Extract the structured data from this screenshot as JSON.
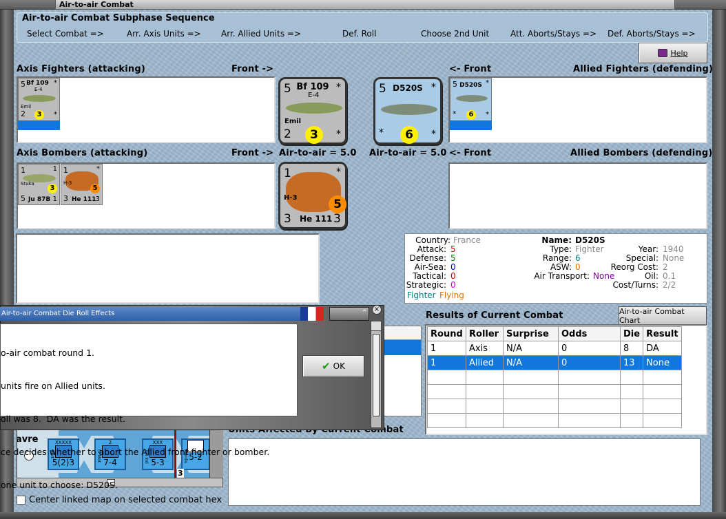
{
  "window": {
    "title": "Air-to-air Combat"
  },
  "sequence": {
    "title": "Air-to-air Combat Subphase Sequence",
    "steps": [
      "Select Combat =>",
      "Arr. Axis Units =>",
      "Arr. Allied Units =>",
      "Def. Roll",
      "Choose 2nd Unit",
      "Att. Aborts/Stays =>",
      "Def. Aborts/Stays =>"
    ]
  },
  "help_label": "Help",
  "sections": {
    "axis_fighters": "Axis Fighters (attacking)",
    "allied_fighters": "Allied Fighters (defending)",
    "axis_bombers": "Axis Bombers (attacking)",
    "allied_bombers": "Allied Bombers (defending)",
    "front_right": "Front ->",
    "front_left": "<- Front",
    "axis_air_to_air": "Air-to-air = 5.0",
    "allied_air_to_air": "Air-to-air = 5.0"
  },
  "units": {
    "bf109": {
      "name": "Bf 109",
      "variant": "E-4",
      "pilot": "Emil",
      "attack": "5",
      "defense": "2",
      "range": "3",
      "star": "*"
    },
    "d520": {
      "name": "D520S",
      "attack": "5",
      "range": "6",
      "star": "*"
    },
    "ju87": {
      "name": "Ju 87B",
      "type_label": "Stuka",
      "tl": "1",
      "tr": "1",
      "bl": "5",
      "br": "1",
      "range": "3"
    },
    "he111": {
      "name": "He 111",
      "variant": "H-3",
      "tl": "1",
      "bl": "3",
      "br": "3",
      "range": "5",
      "star": "*"
    }
  },
  "info": {
    "country_label": "Country:",
    "country": "France",
    "attack_label": "Attack:",
    "attack": "5",
    "defense_label": "Defense:",
    "defense": "5",
    "airsea_label": "Air-Sea:",
    "airsea": "0",
    "tactical_label": "Tactical:",
    "tactical": "0",
    "strategic_label": "Strategic:",
    "strategic": "0",
    "name_label": "Name:",
    "name": "D520S",
    "type_label": "Type:",
    "type": "Fighter",
    "range_label": "Range:",
    "range": "6",
    "asw_label": "ASW:",
    "asw": "0",
    "air_transport_label": "Air Transport:",
    "air_transport": "None",
    "year_label": "Year:",
    "year": "1940",
    "special_label": "Special:",
    "special": "None",
    "reorg_label": "Reorg Cost:",
    "reorg": "2",
    "oil_label": "Oil:",
    "oil": "0.1",
    "cost_label": "Cost/Turns:",
    "cost": "2/2",
    "tag1": "Fighter",
    "tag2": "Flying"
  },
  "results": {
    "title": "Results of Current Combat",
    "chart_button": "Air-to-air Combat Chart",
    "headers": [
      "Round",
      "Roller",
      "Surprise",
      "Odds",
      "Die",
      "Result"
    ],
    "rows": [
      [
        "1",
        "Axis",
        "N/A",
        "0",
        "8",
        "DA"
      ],
      [
        "1",
        "Allied",
        "N/A",
        "0",
        "13",
        "None"
      ]
    ]
  },
  "dialog": {
    "title": "Air-to-air Combat Die Roll Effects",
    "lines": [
      "o-air combat round 1.",
      "units fire on Allied units.",
      "oll was 8.  DA was the result.",
      "ce decides whether to abort the Allied front fighter or bomber.",
      "one unit to choose: D520S."
    ],
    "ok_label": "OK"
  },
  "map": {
    "city": "avre",
    "units": [
      {
        "size": "XXXXX",
        "strength": "5(2)3",
        "name": "Gort"
      },
      {
        "size": "2",
        "strength": "7-4",
        "name": "IV Mot"
      },
      {
        "size": "XXX",
        "strength": "5-3",
        "name": "XIII Ind"
      },
      {
        "size": "",
        "strength": "5-2",
        "name": "Mardis"
      }
    ],
    "hex_label": "3"
  },
  "units_affected_label": "Units Affected by Current Combat",
  "center_map_label": "Center linked map on selected combat hex",
  "colors": {
    "selection": "#1177dd",
    "fighter": "#008080",
    "flying": "#e07000",
    "attack": "#cc0000",
    "defense": "#008000",
    "airsea": "#0000cc",
    "strategic": "#cc00cc",
    "grey_value": "#8a8a8a"
  }
}
